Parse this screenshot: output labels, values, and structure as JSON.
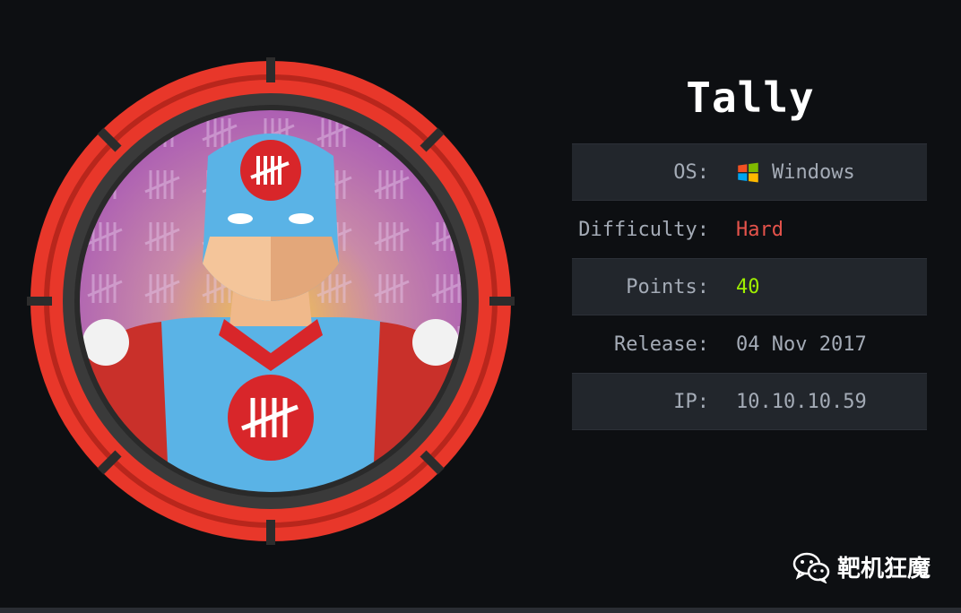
{
  "machine": {
    "name": "Tally"
  },
  "info": {
    "rows": [
      {
        "label": "OS:",
        "value": "Windows",
        "icon": "windows-icon"
      },
      {
        "label": "Difficulty:",
        "value": "Hard"
      },
      {
        "label": "Points:",
        "value": "40"
      },
      {
        "label": "Release:",
        "value": "04 Nov 2017"
      },
      {
        "label": "IP:",
        "value": "10.10.10.59"
      }
    ]
  },
  "footer": {
    "text": "靶机狂魔",
    "icon": "wechat-icon"
  },
  "colors": {
    "background": "#0d0f12",
    "row_shade": "#22262c",
    "difficulty_hard": "#e5534b",
    "points": "#9fef00",
    "badge_red": "#e8372a",
    "hero_blue": "#5ab3e6"
  }
}
